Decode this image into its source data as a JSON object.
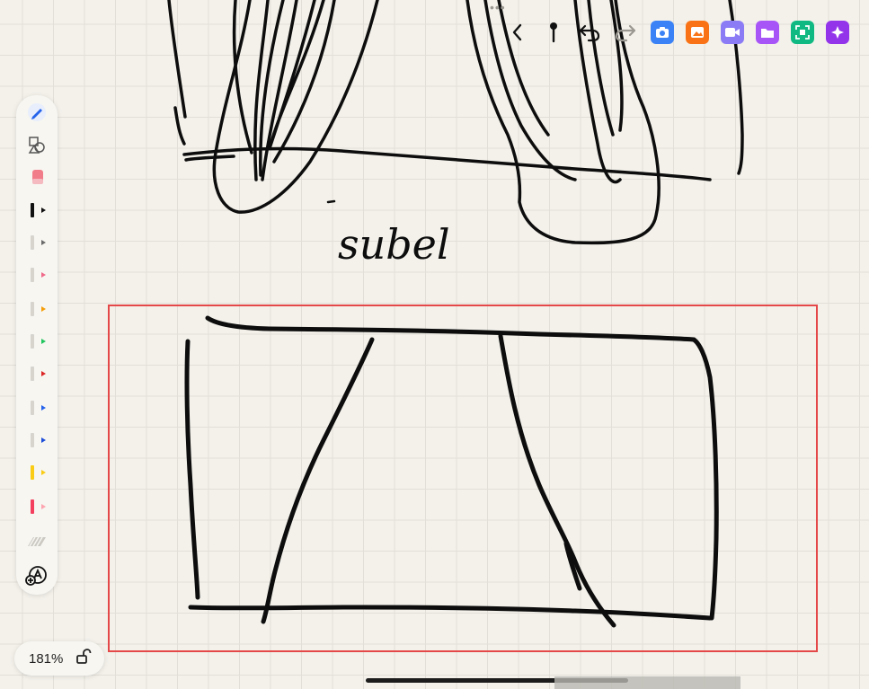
{
  "toolbar": {
    "items": [
      {
        "name": "back-icon"
      },
      {
        "name": "pin-icon"
      },
      {
        "name": "undo-icon"
      },
      {
        "name": "redo-icon"
      },
      {
        "name": "camera-icon",
        "color": "#3b82f6"
      },
      {
        "name": "image-icon",
        "color": "#f97316"
      },
      {
        "name": "video-icon",
        "color": "#8b7cf6"
      },
      {
        "name": "folder-icon",
        "color": "#a855f7"
      },
      {
        "name": "scan-icon",
        "color": "#10b981"
      },
      {
        "name": "sparkle-icon",
        "color": "#9333ea"
      }
    ]
  },
  "palette": {
    "tools": [
      "pencil-icon",
      "shapes-icon",
      "eraser-icon"
    ],
    "pens": [
      {
        "color": "#111111",
        "selected": true
      },
      {
        "color": "#6b6b6b"
      },
      {
        "color": "#f06a8a"
      },
      {
        "color": "#f59e0b"
      },
      {
        "color": "#22c55e"
      },
      {
        "color": "#dc2626"
      },
      {
        "color": "#2563eb"
      },
      {
        "color": "#1d4ed8"
      },
      {
        "color": "#facc15"
      },
      {
        "color": "#f43f5e"
      }
    ]
  },
  "canvas": {
    "handwritten_word": "subel"
  },
  "zoom": {
    "label": "181%"
  }
}
